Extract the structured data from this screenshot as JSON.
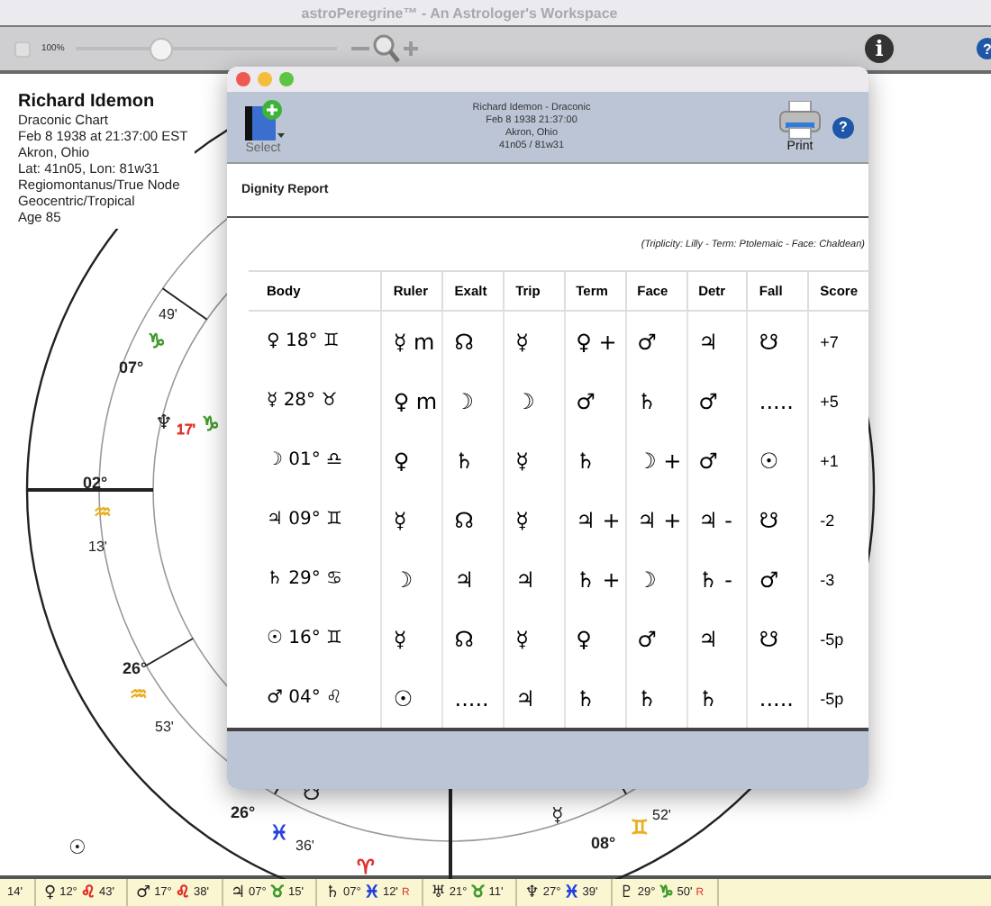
{
  "window": {
    "title": "astroPeregrine™ - An Astrologer's Workspace"
  },
  "toolbar": {
    "checkbox": {
      "checked": false
    },
    "zoom_label": "100%",
    "zoom_slider": {
      "level": 0.32
    },
    "info_label": "i",
    "help_label": "?"
  },
  "chart_info": {
    "name": "Richard Idemon",
    "lines": [
      "Draconic Chart",
      "Feb 8 1938 at 21:37:00 EST",
      "Akron, Ohio",
      "Lat: 41n05, Lon: 81w31",
      "Regiomontanus/True Node",
      "Geocentric/Tropical",
      "Age 85"
    ]
  },
  "chart_labels": [
    {
      "text": "49'",
      "kind": "minute"
    },
    {
      "text": "♑",
      "kind": "sign",
      "color": "#3f9a2c"
    },
    {
      "text": "07°",
      "kind": "degree"
    },
    {
      "text": "♆",
      "kind": "planet"
    },
    {
      "text": "17'",
      "kind": "minute",
      "color": "#e0302a"
    },
    {
      "text": "♑",
      "kind": "sign",
      "color": "#3f9a2c"
    },
    {
      "text": "02°",
      "kind": "degree"
    },
    {
      "text": "♒",
      "kind": "sign",
      "color": "#e8b020"
    },
    {
      "text": "13'",
      "kind": "minute"
    },
    {
      "text": "26°",
      "kind": "degree"
    },
    {
      "text": "♒",
      "kind": "sign",
      "color": "#e8b020"
    },
    {
      "text": "53'",
      "kind": "minute"
    },
    {
      "text": "☋",
      "kind": "planet"
    },
    {
      "text": "26°",
      "kind": "degree"
    },
    {
      "text": "♓",
      "kind": "sign",
      "color": "#2340e0"
    },
    {
      "text": "36'",
      "kind": "minute"
    },
    {
      "text": "♈",
      "kind": "sign",
      "color": "#e0302a"
    },
    {
      "text": "☉",
      "kind": "planet"
    },
    {
      "text": "☿",
      "kind": "planet"
    },
    {
      "text": "♊",
      "kind": "sign",
      "color": "#e8b020"
    },
    {
      "text": "52'",
      "kind": "minute"
    },
    {
      "text": "08°",
      "kind": "degree"
    }
  ],
  "report_window": {
    "select_label": "Select",
    "header_lines": [
      "Richard Idemon - Draconic",
      "Feb 8 1938 21:37:00",
      "Akron, Ohio",
      "41n05 / 81w31"
    ],
    "print_label": "Print",
    "help_label": "?",
    "section_title": "Dignity Report",
    "note": "(Triplicity: Lilly - Term: Ptolemaic - Face: Chaldean)",
    "table": {
      "columns": [
        "Body",
        "Ruler",
        "Exalt",
        "Trip",
        "Term",
        "Face",
        "Detr",
        "Fall",
        "Score"
      ],
      "rows": [
        [
          "♀ 18° ♊",
          "☿ m",
          "☊",
          "☿",
          "♀ +",
          "♂",
          "♃",
          "☋",
          "+7"
        ],
        [
          "☿ 28° ♉",
          "♀ m",
          "☽",
          "☽",
          "♂",
          "♄",
          "♂",
          ".....",
          "+5"
        ],
        [
          "☽ 01° ♎",
          "♀",
          "♄",
          "☿",
          "♄",
          "☽ +",
          "♂",
          "☉",
          "+1"
        ],
        [
          "♃ 09° ♊",
          "☿",
          "☊",
          "☿",
          "♃ +",
          "♃ +",
          "♃ -",
          "☋",
          "-2"
        ],
        [
          "♄ 29° ♋",
          "☽",
          "♃",
          "♃",
          "♄ +",
          "☽",
          "♄ -",
          "♂",
          "-3"
        ],
        [
          "☉ 16° ♊",
          "☿",
          "☊",
          "☿",
          "♀",
          "♂",
          "♃",
          "☋",
          "-5p"
        ],
        [
          "♂ 04° ♌",
          "☉",
          ".....",
          "♃",
          "♄",
          "♄",
          "♄",
          ".....",
          "-5p"
        ]
      ]
    }
  },
  "status_bar": {
    "items": [
      {
        "minutes": "14'"
      },
      {
        "planet": "♀",
        "degree": "12°",
        "sign": "♌",
        "color": "#e0302a",
        "minutes": "43'"
      },
      {
        "planet": "♂",
        "degree": "17°",
        "sign": "♌",
        "color": "#e0302a",
        "minutes": "38'"
      },
      {
        "planet": "♃",
        "degree": "07°",
        "sign": "♉",
        "color": "#3f9a2c",
        "minutes": "15'"
      },
      {
        "planet": "♄",
        "degree": "07°",
        "sign": "♓",
        "color": "#2340e0",
        "minutes": "12'",
        "retrograde": "R"
      },
      {
        "planet": "♅",
        "degree": "21°",
        "sign": "♉",
        "color": "#3f9a2c",
        "minutes": "11'"
      },
      {
        "planet": "♆",
        "degree": "27°",
        "sign": "♓",
        "color": "#2340e0",
        "minutes": "39'"
      },
      {
        "planet": "♇",
        "degree": "29°",
        "sign": "♑",
        "color": "#3f9a2c",
        "minutes": "50'",
        "retrograde": "R"
      }
    ]
  }
}
